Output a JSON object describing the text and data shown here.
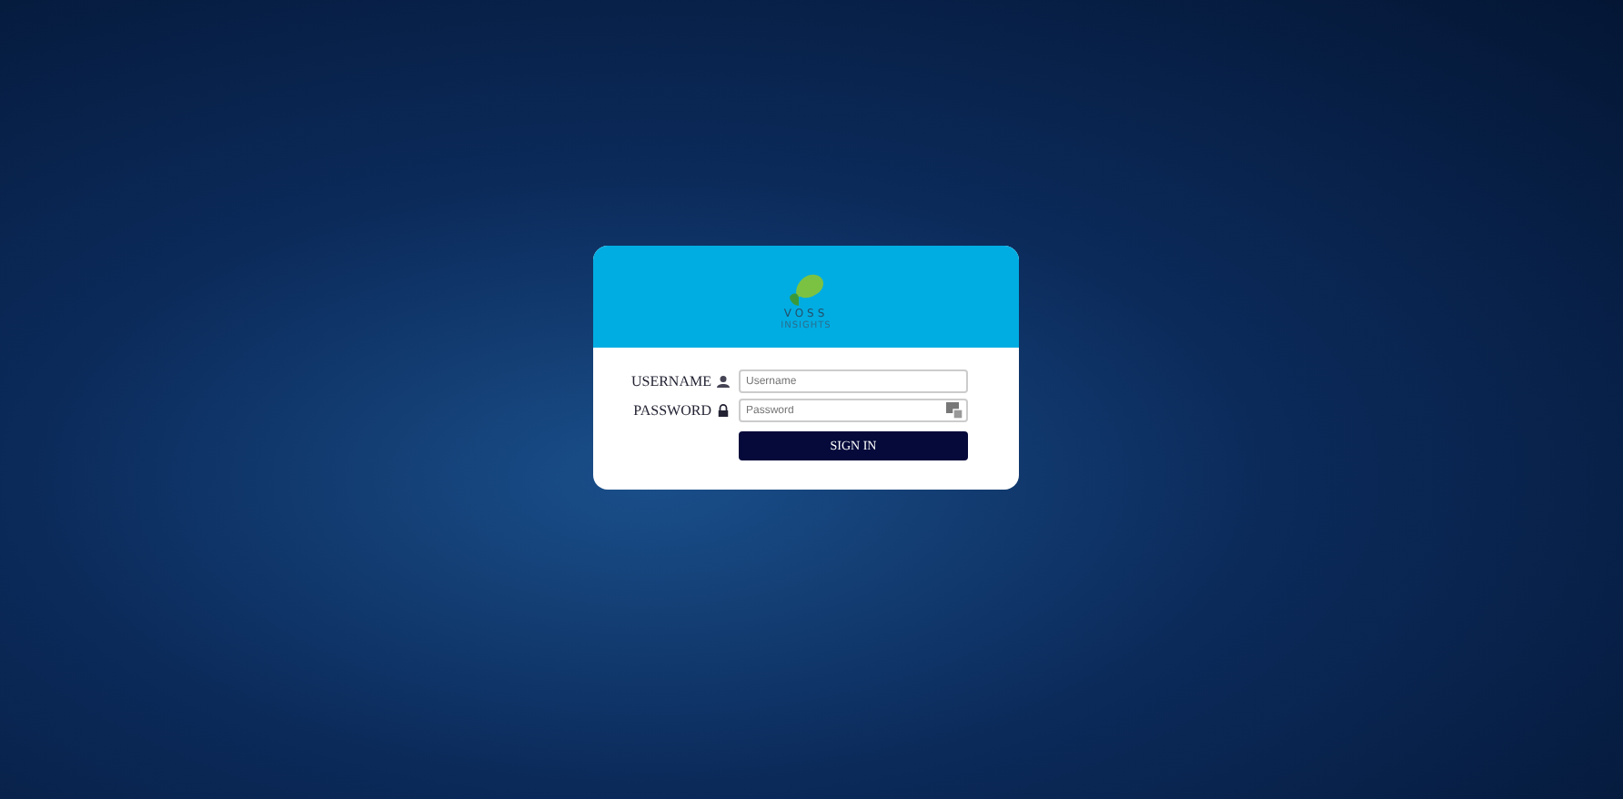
{
  "logo": {
    "name": "VOSS",
    "tagline": "INSIGHTS"
  },
  "fields": [
    {
      "label": "USERNAME",
      "kind": "text",
      "placeholder": "Username"
    },
    {
      "label": "PASSWORD",
      "kind": "password",
      "placeholder": "Password"
    }
  ],
  "submit": {
    "label": "SIGN IN"
  }
}
